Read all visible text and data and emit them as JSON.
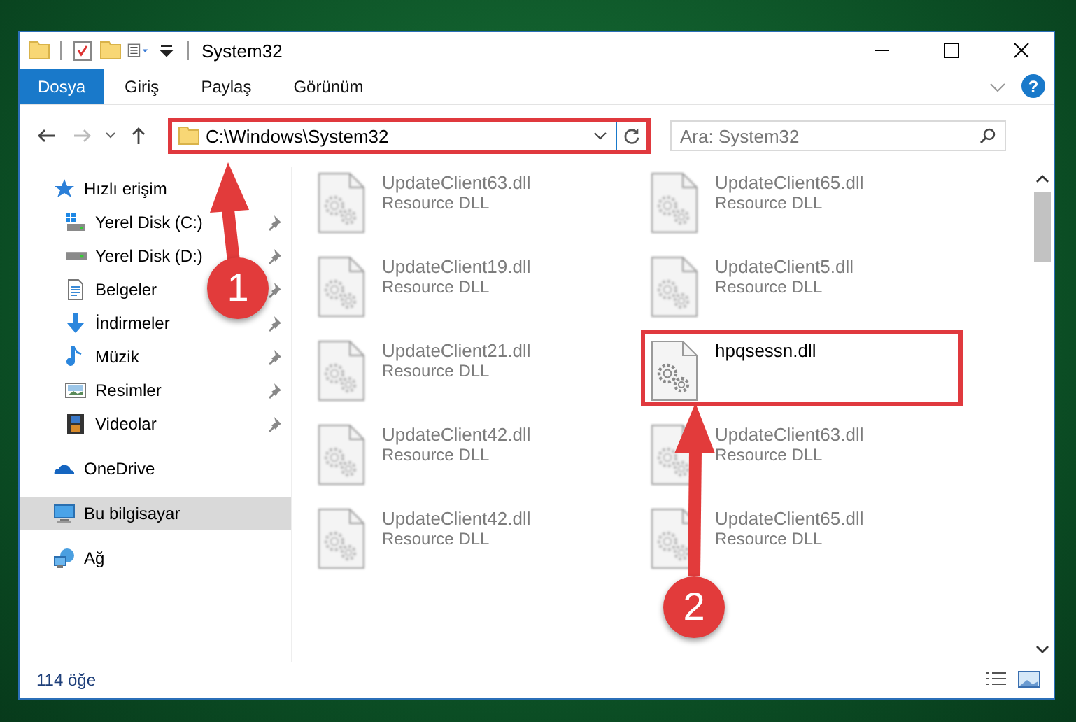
{
  "window": {
    "title": "System32"
  },
  "ribbon": {
    "file_tab": "Dosya",
    "tabs": [
      "Giriş",
      "Paylaş",
      "Görünüm"
    ],
    "help": "?"
  },
  "address_bar": {
    "path": "C:\\Windows\\System32",
    "highlighted": true,
    "search": {
      "placeholder": "Ara: System32"
    }
  },
  "sidebar": {
    "items": [
      {
        "label": "Hızlı erişim",
        "kind": "star",
        "selected": false,
        "children": [
          {
            "label": "Yerel Disk (C:)",
            "kind": "windows-drive",
            "pinned": true
          },
          {
            "label": "Yerel Disk (D:)",
            "kind": "drive",
            "pinned": true
          },
          {
            "label": "Belgeler",
            "kind": "document",
            "pinned": true
          },
          {
            "label": "İndirmeler",
            "kind": "download",
            "pinned": true
          },
          {
            "label": "Müzik",
            "kind": "music",
            "pinned": true
          },
          {
            "label": "Resimler",
            "kind": "pictures",
            "pinned": true
          },
          {
            "label": "Videolar",
            "kind": "video",
            "pinned": true
          }
        ]
      },
      {
        "label": "OneDrive",
        "kind": "cloud",
        "selected": false
      },
      {
        "label": "Bu bilgisayar",
        "kind": "computer",
        "selected": true
      },
      {
        "label": "Ağ",
        "kind": "network",
        "selected": false
      }
    ]
  },
  "files": [
    {
      "name": "UpdateClient63.dll",
      "type": "Resource DLL",
      "blurred": true,
      "highlighted": false
    },
    {
      "name": "UpdateClient65.dll",
      "type": "Resource DLL",
      "blurred": true,
      "highlighted": false
    },
    {
      "name": "UpdateClient19.dll",
      "type": "Resource DLL",
      "blurred": true,
      "highlighted": false
    },
    {
      "name": "UpdateClient5.dll",
      "type": "Resource DLL",
      "blurred": true,
      "highlighted": false
    },
    {
      "name": "UpdateClient21.dll",
      "type": "Resource DLL",
      "blurred": true,
      "highlighted": false
    },
    {
      "name": "hpqsessn.dll",
      "blurred": false,
      "highlighted": true
    },
    {
      "name": "UpdateClient42.dll",
      "type": "Resource DLL",
      "blurred": true,
      "highlighted": false
    },
    {
      "name": "UpdateClient63.dll",
      "type": "Resource DLL",
      "blurred": true,
      "highlighted": false
    },
    {
      "name": "UpdateClient42.dll",
      "type": "Resource DLL",
      "blurred": true,
      "highlighted": false
    },
    {
      "name": "UpdateClient65.dll",
      "type": "Resource DLL",
      "blurred": true,
      "highlighted": false
    }
  ],
  "status_bar": {
    "item_count": "114 öğe"
  },
  "callouts": [
    {
      "number": "1"
    },
    {
      "number": "2"
    }
  ]
}
